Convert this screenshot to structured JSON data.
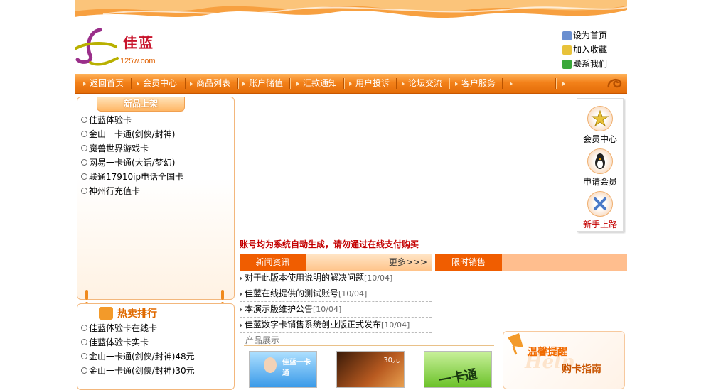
{
  "header": {
    "logo_name": "佳蓝",
    "logo_url": "125w.com",
    "quick_links": [
      {
        "label": "设为首页",
        "icon": "home-icon"
      },
      {
        "label": "加入收藏",
        "icon": "star-icon"
      },
      {
        "label": "联系我们",
        "icon": "contact-icon"
      }
    ]
  },
  "nav": [
    "返回首页",
    "会员中心",
    "商品列表",
    "账户储值",
    "汇款通知",
    "用户投诉",
    "论坛交流",
    "客户服务"
  ],
  "new_products": {
    "title": "新品上架",
    "items": [
      "佳蓝体验卡",
      "金山一卡通(剑侠/封神)",
      "魔兽世界游戏卡",
      "网易一卡通(大话/梦幻)",
      "联通17910ip电话全国卡",
      "神州行充值卡"
    ]
  },
  "hot": {
    "title": "热卖排行",
    "items": [
      "佳蓝体验卡在线卡",
      "佳蓝体验卡实卡",
      "金山一卡通(剑侠/封神)48元",
      "金山一卡通(剑侠/封神)30元"
    ]
  },
  "marquee": "账号均为系统自动生成，请勿通过在线支付购买",
  "member_panel": [
    {
      "label": "会员中心",
      "icon": "member-star-icon"
    },
    {
      "label": "申请会员",
      "icon": "penguin-icon"
    },
    {
      "label": "新手上路",
      "icon": "tools-icon"
    }
  ],
  "news": {
    "tab": "新闻资讯",
    "more": "更多>>>",
    "items": [
      {
        "title": "对于此版本使用说明的解决问题",
        "date": "[10/04]"
      },
      {
        "title": "佳蓝在线提供的测试账号",
        "date": "[10/04]"
      },
      {
        "title": "本演示版维护公告",
        "date": "[10/04]"
      },
      {
        "title": "佳蓝数字卡销售系统创业版正式发布",
        "date": "[10/04]"
      }
    ]
  },
  "limited_sale": {
    "tab": "限时销售"
  },
  "products": {
    "title": "产品展示",
    "items": [
      {
        "label": "佳蓝一卡通",
        "color": "#2f8fe0"
      },
      {
        "label": "30元",
        "color": "#8a3b10"
      },
      {
        "label": "一卡通",
        "color": "#6cc22a"
      }
    ]
  },
  "tip": {
    "title": "温馨提醒",
    "subtitle": "购卡指南",
    "watermark": "Help"
  },
  "colors": {
    "accent": "#f05d00",
    "nav_bg": "#f3811a",
    "marquee": "#c40000"
  }
}
